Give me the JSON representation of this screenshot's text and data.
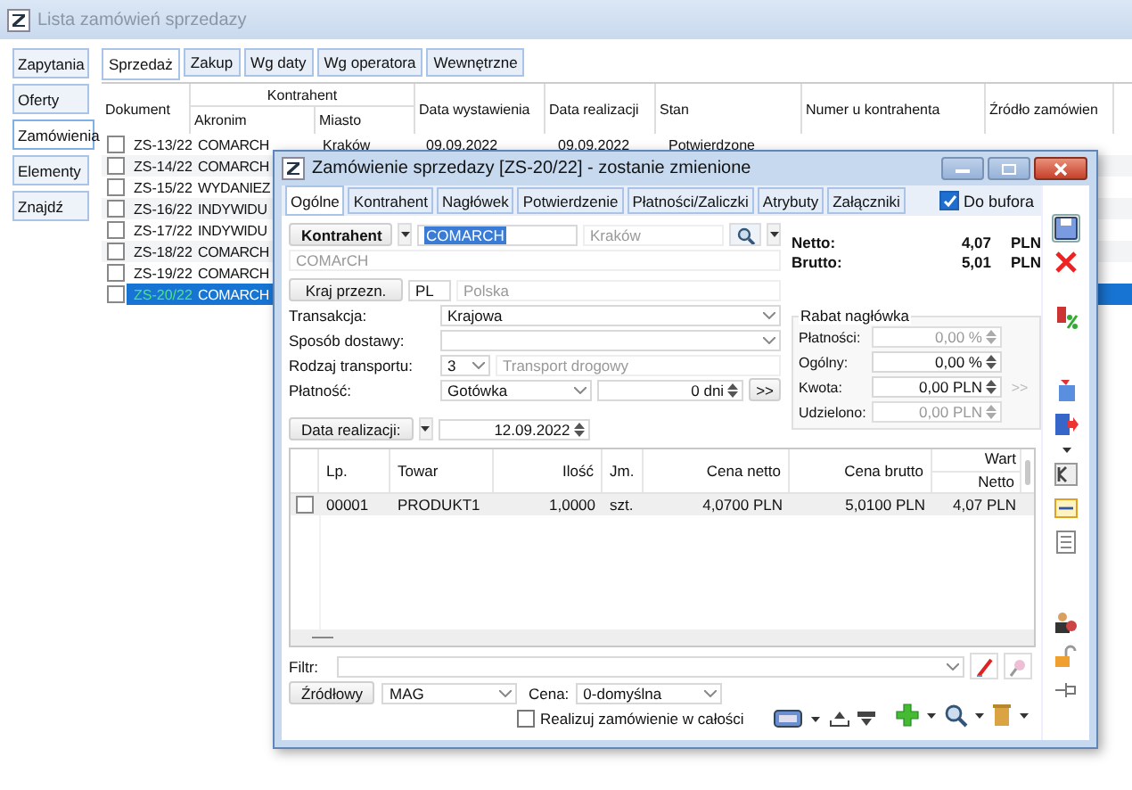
{
  "list_window": {
    "title": "Lista zamówień sprzedazy"
  },
  "nav": [
    {
      "label": "Zapytania",
      "selected": false
    },
    {
      "label": "Oferty",
      "selected": false
    },
    {
      "label": "Zamówienia",
      "selected": true
    },
    {
      "label": "Elementy",
      "selected": false
    },
    {
      "label": "Znajdź",
      "selected": false
    }
  ],
  "tabs": [
    {
      "label": "Sprzedaż",
      "selected": true
    },
    {
      "label": "Zakup",
      "selected": false
    },
    {
      "label": "Wg daty",
      "selected": false
    },
    {
      "label": "Wg operatora",
      "selected": false
    },
    {
      "label": "Wewnętrzne",
      "selected": false
    }
  ],
  "table": {
    "group_header": "Kontrahent",
    "columns": [
      "Dokument",
      "Akronim",
      "Miasto",
      "Data wystawienia",
      "Data realizacji",
      "Stan",
      "Numer u kontrahenta",
      "Źródło zamówien"
    ],
    "rows": [
      {
        "checked": false,
        "selected": false,
        "cells": [
          "ZS-13/22",
          "COMARCH",
          "Kraków",
          "09.09.2022",
          "09.09.2022",
          "Potwierdzone"
        ]
      },
      {
        "checked": false,
        "selected": false,
        "cells": [
          "ZS-14/22",
          "COMARCH"
        ]
      },
      {
        "checked": false,
        "selected": false,
        "cells": [
          "ZS-15/22",
          "WYDANIEZ"
        ]
      },
      {
        "checked": false,
        "selected": false,
        "cells": [
          "ZS-16/22",
          "INDYWIDU"
        ]
      },
      {
        "checked": false,
        "selected": false,
        "cells": [
          "ZS-17/22",
          "INDYWIDU"
        ]
      },
      {
        "checked": false,
        "selected": false,
        "cells": [
          "ZS-18/22",
          "COMARCH"
        ]
      },
      {
        "checked": false,
        "selected": false,
        "cells": [
          "ZS-19/22",
          "COMARCH"
        ]
      },
      {
        "checked": false,
        "selected": true,
        "cells": [
          "ZS-20/22",
          "COMARCH"
        ]
      }
    ]
  },
  "dialog": {
    "title": "Zamówienie sprzedazy [ZS-20/22] - zostanie zmienione",
    "tabs": [
      {
        "label": "Ogólne",
        "selected": true
      },
      {
        "label": "Kontrahent",
        "selected": false
      },
      {
        "label": "Nagłówek",
        "selected": false
      },
      {
        "label": "Potwierdzenie",
        "selected": false
      },
      {
        "label": "Płatności/Zaliczki",
        "selected": false
      },
      {
        "label": "Atrybuty",
        "selected": false
      },
      {
        "label": "Załączniki",
        "selected": false
      }
    ],
    "do_bufora": {
      "label": "Do bufora",
      "checked": true
    },
    "kontrahent": {
      "button": "Kontrahent",
      "akronim": "COMARCH",
      "miasto": "Kraków",
      "nazwa": "COMArCH"
    },
    "kraj": {
      "button": "Kraj przezn.",
      "code": "PL",
      "name": "Polska"
    },
    "fields": [
      {
        "kind": "select",
        "label": "Transakcja:",
        "value": "Krajowa"
      },
      {
        "kind": "select",
        "label": "Sposób dostawy:"
      },
      {
        "kind": "transport",
        "label": "Rodzaj transportu:",
        "value": "3",
        "name": "Transport drogowy"
      },
      {
        "kind": "payment",
        "label": "Płatność:",
        "value": "Gotówka",
        "days": "0 dni",
        "more": ">>"
      }
    ],
    "data_realizacji": {
      "button": "Data realizacji:",
      "value": "12.09.2022"
    },
    "totals": [
      {
        "label": "Netto:",
        "value": "4,07",
        "currency": "PLN"
      },
      {
        "label": "Brutto:",
        "value": "5,01",
        "currency": "PLN"
      }
    ],
    "rabat": {
      "title": "Rabat nagłówka",
      "rows": [
        {
          "label": "Płatności:",
          "value": "0,00 %",
          "disabled": true
        },
        {
          "label": "Ogólny:",
          "value": "0,00 %",
          "disabled": false
        },
        {
          "label": "Kwota:",
          "value": "0,00 PLN",
          "disabled": false,
          "more": ">>"
        },
        {
          "label": "Udzielono:",
          "value": "0,00 PLN",
          "disabled": true
        }
      ]
    },
    "items": {
      "columns": [
        "Lp.",
        "Towar",
        "Ilość",
        "Jm.",
        "Cena netto",
        "Cena brutto"
      ],
      "group_header": "Wart",
      "sub_header": "Netto",
      "rows": [
        {
          "checked": false,
          "cells": [
            "00001",
            "PRODUKT1",
            "1,0000",
            "szt.",
            "4,0700 PLN",
            "5,0100 PLN",
            "4,07 PLN"
          ]
        }
      ]
    },
    "filter": {
      "label": "Filtr:"
    },
    "bottom": {
      "source_button": "Źródłowy",
      "warehouse": "MAG",
      "price_label": "Cena:",
      "price": "0-domyślna",
      "realize": {
        "label": "Realizuj zamówienie w całości",
        "checked": false
      }
    }
  }
}
